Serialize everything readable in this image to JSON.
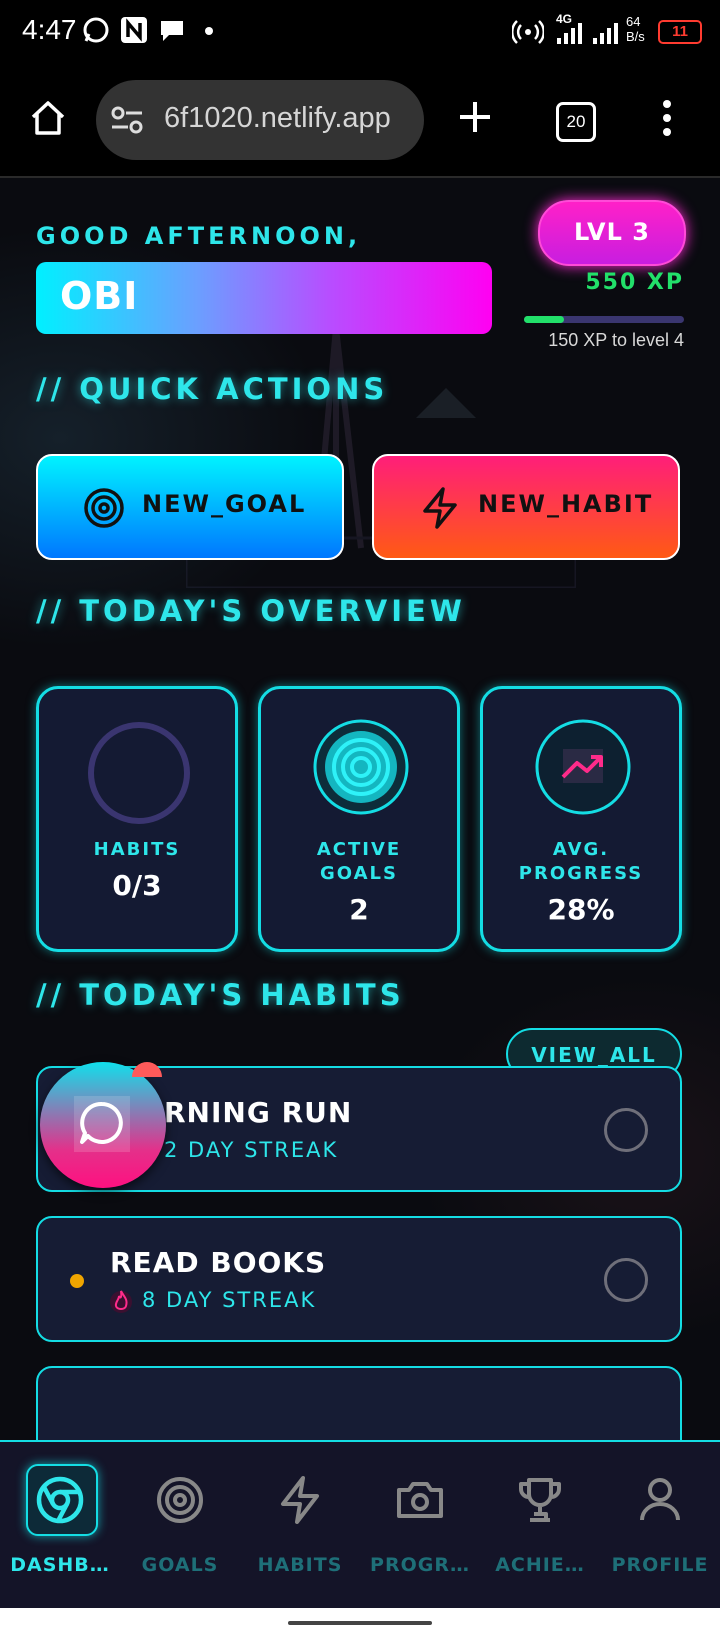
{
  "status_bar": {
    "time": "4:47",
    "network": "4G",
    "speed": "64\nB/s",
    "battery": "11"
  },
  "browser": {
    "url": "6f1020.netlify.app",
    "tab_count": "20"
  },
  "header": {
    "greeting": "GOOD AFTERNOON,",
    "user_name": "OBI",
    "level": "LVL 3",
    "xp": "550 XP",
    "xp_progress": 0.25,
    "xp_note": "150 XP to level 4"
  },
  "quick_actions": {
    "title": "// QUICK ACTIONS",
    "new_goal": "NEW_GOAL",
    "new_habit": "NEW_HABIT"
  },
  "overview": {
    "title": "// TODAY'S OVERVIEW",
    "cards": [
      {
        "label_line1": "HABITS",
        "label_line2": "",
        "value": "0/3"
      },
      {
        "label_line1": "ACTIVE",
        "label_line2": "GOALS",
        "value": "2"
      },
      {
        "label_line1": "AVG.",
        "label_line2": "PROGRESS",
        "value": "28%"
      }
    ]
  },
  "habits": {
    "title": "// TODAY'S HABITS",
    "view_all": "VIEW_ALL",
    "items": [
      {
        "name": "RNING RUN",
        "streak": "2 DAY STREAK"
      },
      {
        "name": "READ BOOKS",
        "streak": "8 DAY STREAK"
      }
    ]
  },
  "nav": {
    "items": [
      {
        "label": "DASHB…"
      },
      {
        "label": "GOALS"
      },
      {
        "label": "HABITS"
      },
      {
        "label": "PROGR…"
      },
      {
        "label": "ACHIE…"
      },
      {
        "label": "PROFILE"
      }
    ]
  },
  "colors": {
    "accent": "#2ee6ea",
    "background": "#0a0b10",
    "level_pink": "#ff20c8",
    "xp_green": "#22e06a"
  }
}
